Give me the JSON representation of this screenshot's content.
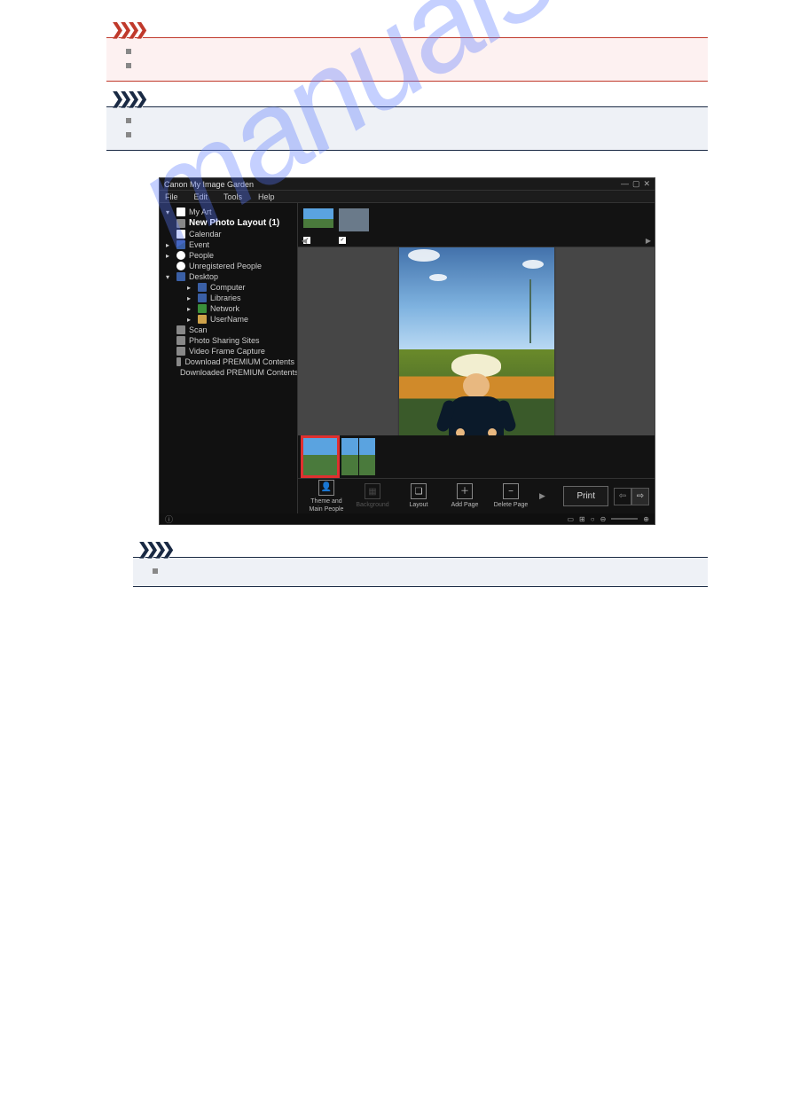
{
  "watermark_text": "manuals.com",
  "notices": {
    "important_items": [
      "",
      ""
    ],
    "note1_items": [
      "",
      ""
    ],
    "note2_items": [
      ""
    ]
  },
  "app": {
    "title": "Canon My Image Garden",
    "menus": [
      "File",
      "Edit",
      "Tools",
      "Help"
    ],
    "sidebar": {
      "my_art": "My Art",
      "new_layout": "New Photo Layout (1)",
      "calendar": "Calendar",
      "event": "Event",
      "people": "People",
      "unregistered": "Unregistered People",
      "desktop": "Desktop",
      "computer": "Computer",
      "libraries": "Libraries",
      "network": "Network",
      "username": "UserName",
      "scan": "Scan",
      "sharing": "Photo Sharing Sites",
      "vfc": "Video Frame Capture",
      "dpc": "Download PREMIUM Contents",
      "dpc2": "Downloaded PREMIUM Contents"
    },
    "toolbar": {
      "theme": "Theme and\nMain People",
      "background": "Background",
      "layout": "Layout",
      "add_page": "Add Page",
      "delete_page": "Delete Page",
      "print": "Print"
    }
  }
}
